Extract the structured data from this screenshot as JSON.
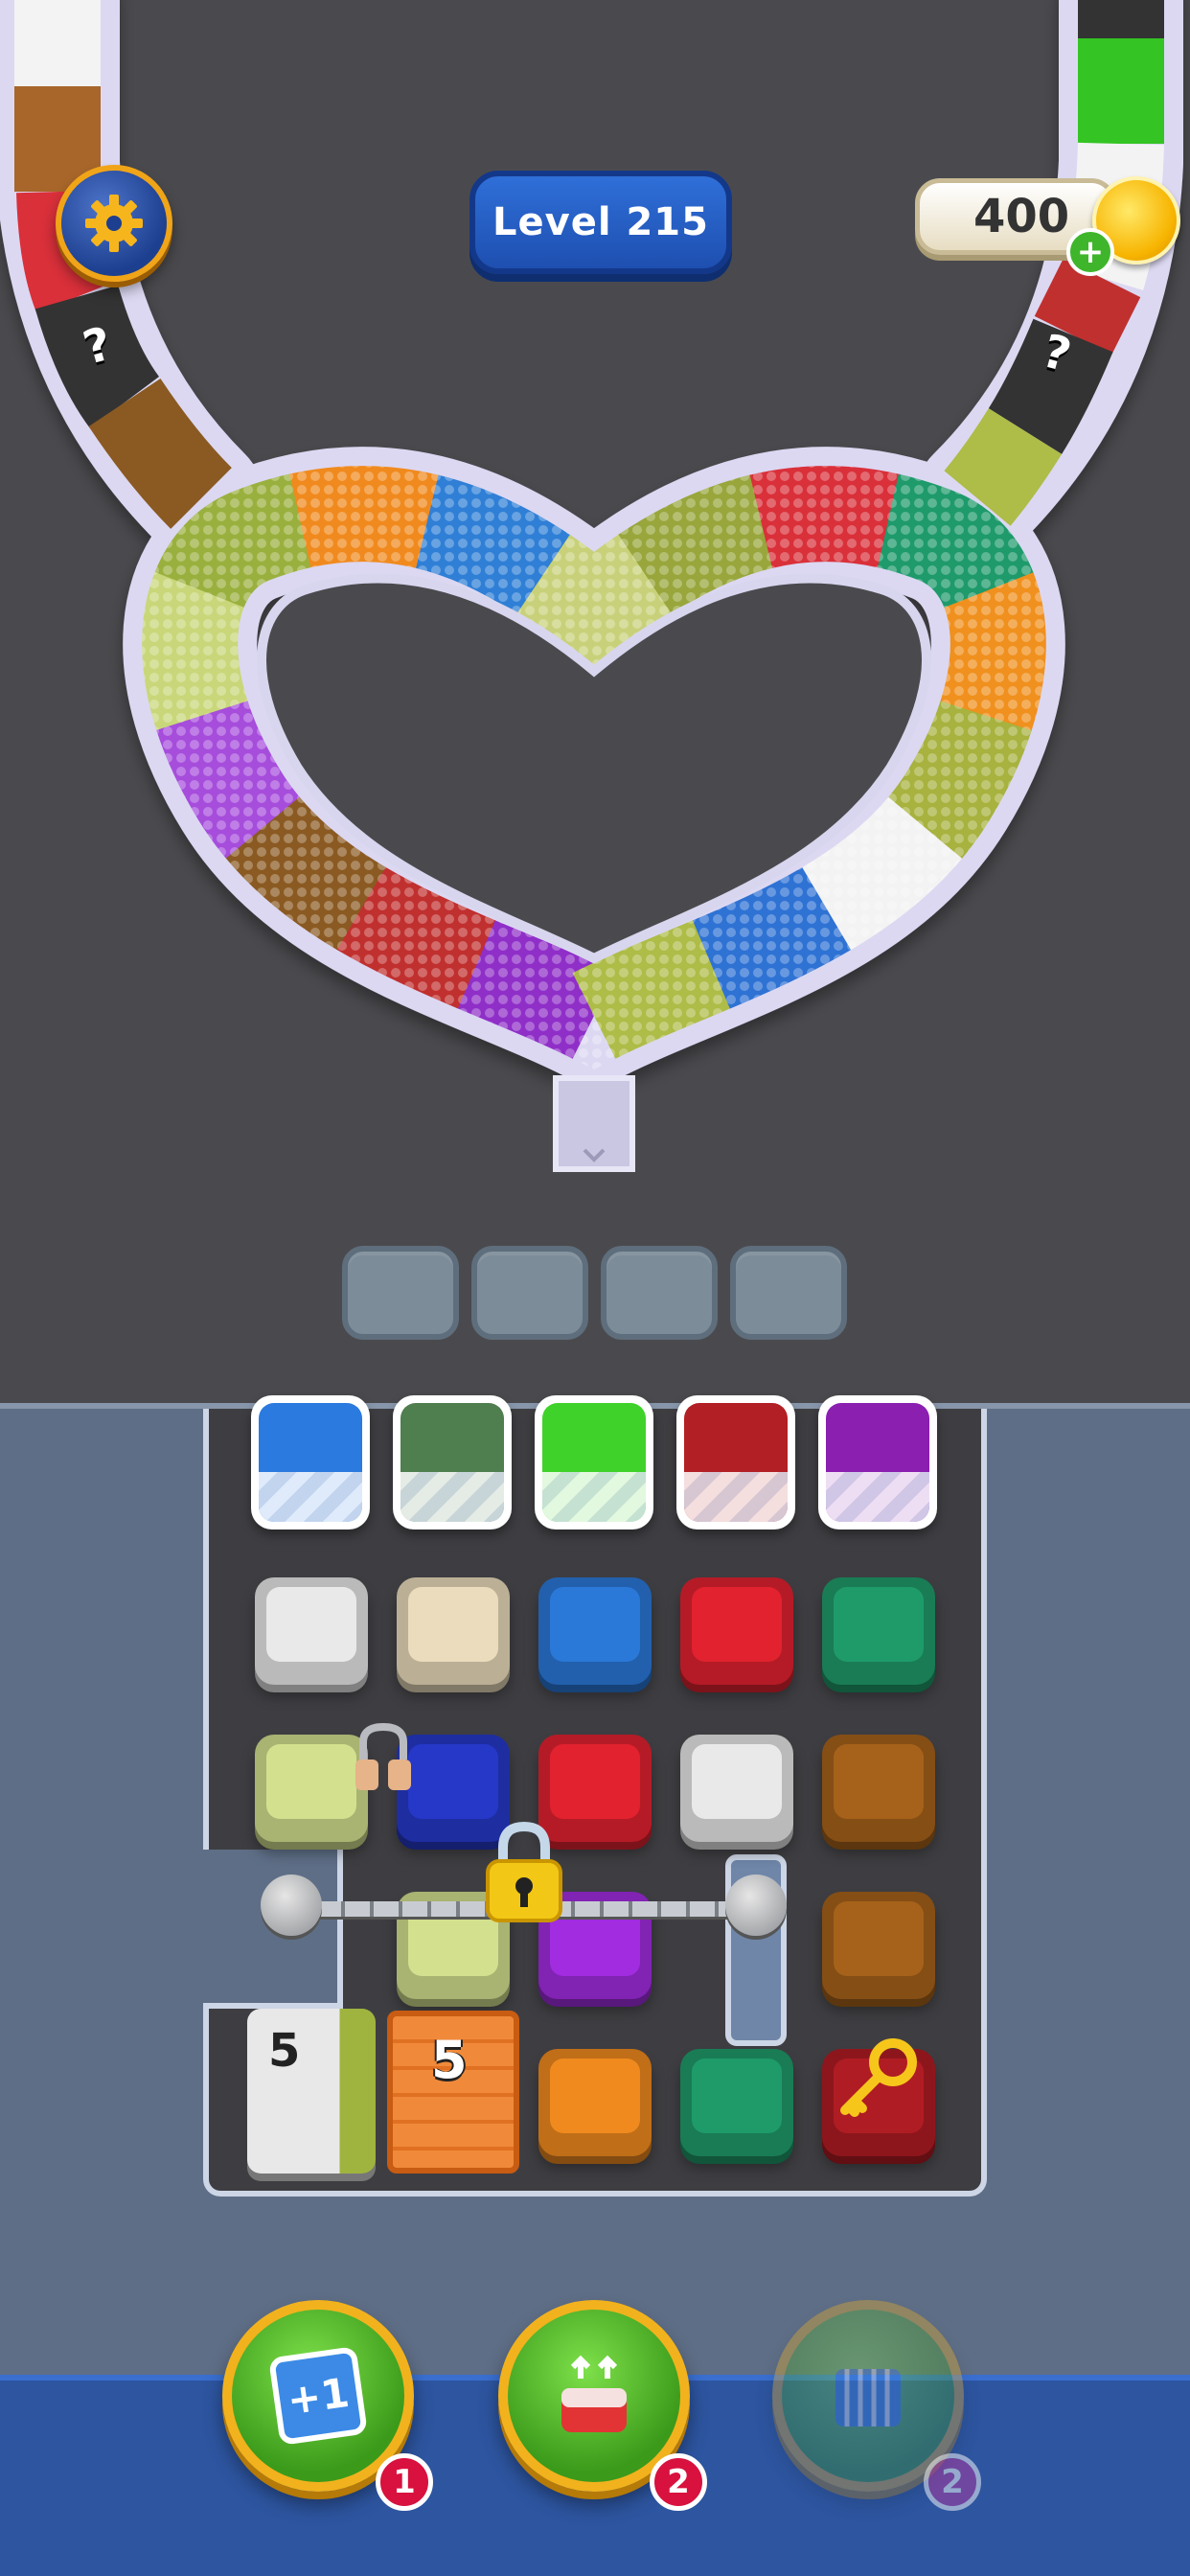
{
  "hud": {
    "level_label": "Level 215",
    "coins": "400",
    "coin_plus": "+",
    "settings_icon": "gear-icon"
  },
  "track": {
    "left_mystery": "?",
    "right_mystery": "?",
    "segment_colors": [
      "#8f2fc8",
      "#c0302f",
      "#8a5a22",
      "#a64ddc",
      "#c9d77a",
      "#9ab03e",
      "#f08a1e",
      "#2f7fd6",
      "#c8d17a",
      "#98a63c",
      "#d9303a",
      "#1e9a6b",
      "#f0901e",
      "#a7b23f",
      "#f3f3f3",
      "#2e72d4",
      "#aebc48"
    ]
  },
  "holders": [
    {
      "color": "#2a7ae0"
    },
    {
      "color": "#4f7e4f"
    },
    {
      "color": "#3fd22a"
    },
    {
      "color": "#b21f25"
    },
    {
      "color": "#8a1fb0"
    }
  ],
  "tiles": {
    "row1": [
      "#e9e9e9",
      "#eadcbc",
      "#2a78d8",
      "#e2222f",
      "#1f9b6a"
    ],
    "row2": [
      "#d3e08e",
      "#2538c8",
      "#e2222f",
      "#e9e9e9",
      "#a6621a"
    ],
    "row3": [
      "#d3e08e",
      "#a12ce0",
      "#a6621a"
    ],
    "row4": [
      "#f08a1e",
      "#1f9b6a",
      "#b01c23"
    ]
  },
  "counters": {
    "gray_block_count": "5",
    "crate_count": "5"
  },
  "boosters": [
    {
      "label": "+1",
      "badge": "1",
      "icon": "add-slot-icon"
    },
    {
      "label": "",
      "badge": "2",
      "icon": "lift-cup-icon"
    },
    {
      "label": "",
      "badge": "2",
      "icon": "cage-icon"
    }
  ],
  "colors": {
    "background": "#4a4a4e",
    "board": "#5e6e86",
    "accent_gold": "#f2b21d",
    "badge_red": "#d8113e"
  }
}
